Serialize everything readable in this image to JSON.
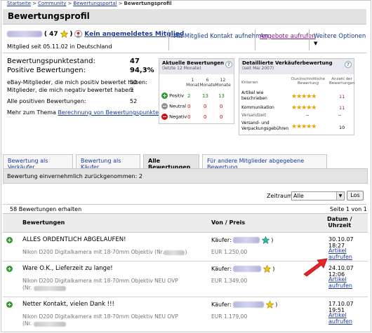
{
  "breadcrumb": [
    "Startseite",
    "Community",
    "Bewertungsportal",
    "Bewertungsprofil"
  ],
  "page_title": "Bewertungsprofil",
  "user": {
    "rating_count": "( 47",
    "rating_close": ")",
    "not_logged_in": "Kein angemeldetes Mitglied",
    "member_since": "Mitglied seit 05.11.02 in Deutschland"
  },
  "top_actions": {
    "contact": "Mit Mitglied Kontakt aufnehmen",
    "offers": "Angebote aufrufen",
    "more": "Weitere Optionen"
  },
  "summary": {
    "points_label": "Bewertungspunktestand:",
    "points_value": "47",
    "positive_label": "Positive Bewertungen:",
    "positive_value": "94,3%",
    "pos_members_label": "eBay-Mitglieder, die mich positiv bewertet haben:",
    "pos_members_value": "50",
    "neg_members_label": "Mitglieder, die mich negativ bewertet haben:",
    "neg_members_value": "3",
    "all_pos_label": "Alle positiven Bewertungen:",
    "all_pos_value": "52",
    "more_prefix": "Mehr zum Thema",
    "more_link": "Berechnung von Bewertungspunkten"
  },
  "current_ratings": {
    "title": "Aktuelle Bewertungen",
    "subtitle": "(letzte 12 Monate)",
    "cols": [
      [
        "1",
        "Monat"
      ],
      [
        "6",
        "Monate"
      ],
      [
        "12",
        "Monate"
      ]
    ],
    "rows": [
      {
        "label": "Positiv",
        "values": [
          "2",
          "13",
          "13"
        ],
        "color": "#1a8a1a"
      },
      {
        "label": "Neutral",
        "values": [
          "0",
          "0",
          "0"
        ],
        "color": "#cc0000"
      },
      {
        "label": "Negativ",
        "values": [
          "0",
          "0",
          "0"
        ],
        "color": "#cc0000"
      }
    ]
  },
  "detailed": {
    "title": "Detaillierte Verkäuferbewertung",
    "subtitle": "(seit Mai 2007)",
    "col_criteria": "Kriterien",
    "col_avg": [
      "Durchschnittliche",
      "Bewertung"
    ],
    "col_count": [
      "Anzahl der",
      "Bewertungen"
    ],
    "rows": [
      {
        "label": [
          "Artikel wie",
          "beschrieben"
        ],
        "stars": "★★★★★",
        "count": "11"
      },
      {
        "label": [
          "Kommunikation"
        ],
        "stars": "★★★★★",
        "count": "11"
      },
      {
        "label": [
          "Versandzeit"
        ],
        "stars": "--",
        "count": "--"
      },
      {
        "label": [
          "Versand- und",
          "Verpackungsgebühren"
        ],
        "stars": "★★★★★",
        "count": "10"
      }
    ]
  },
  "tabs": [
    "Bewertung als Verkäufer",
    "Bewertung als Käufer",
    "Alle Bewertungen",
    "Für andere Mitglieder abgegebene Bewertung"
  ],
  "withdrawn": "Bewertung einvernehmlich zurückgenommen: 2",
  "filter": {
    "label": "Zeitraum:",
    "value": "Alle",
    "button": "Los"
  },
  "received": "58 Bewertungen erhalten",
  "page_info": "Seite 1 von 1",
  "table": {
    "col_ratings": "Bewertungen",
    "col_from": "Von / Preis",
    "col_date": [
      "Datum /",
      "Uhrzeit"
    ]
  },
  "rows": [
    {
      "comment": "ALLES ORDENTLICH ABGELAUFEN!",
      "item": "Nikon D200 Digitalkamera mit 18-70mm Objektiv (Nr.",
      "item2": "",
      "from": "Käufer:",
      "star_color": "#30c0a0",
      "price": "EUR 1.250,00",
      "date": "30.10.07 18:27",
      "link": "Artikel aufrufen"
    },
    {
      "comment": "Ware O.K., Lieferzeit zu lange!",
      "item": "Nikon D200 Digitalkamera mit 18-70mm Objektiv NEU OVP",
      "item2": "(Nr.",
      "from": "Käufer:",
      "star_color": "#f0d000",
      "price": "EUR 1.349,00",
      "date": "24.10.07 12:06",
      "link": "Artikel aufrufen"
    },
    {
      "comment": "Netter Kontakt, vielen Dank !!!",
      "item": "Nikon D200 Digitalkamera mit 18-70mm Objektiv NEU OVP",
      "item2": "(Nr.",
      "from": "Käufer:",
      "star_color": "#f0d000",
      "price": "EUR 1.179,00",
      "date": "17.10.07 19:51",
      "link": "Artikel aufrufen"
    }
  ]
}
